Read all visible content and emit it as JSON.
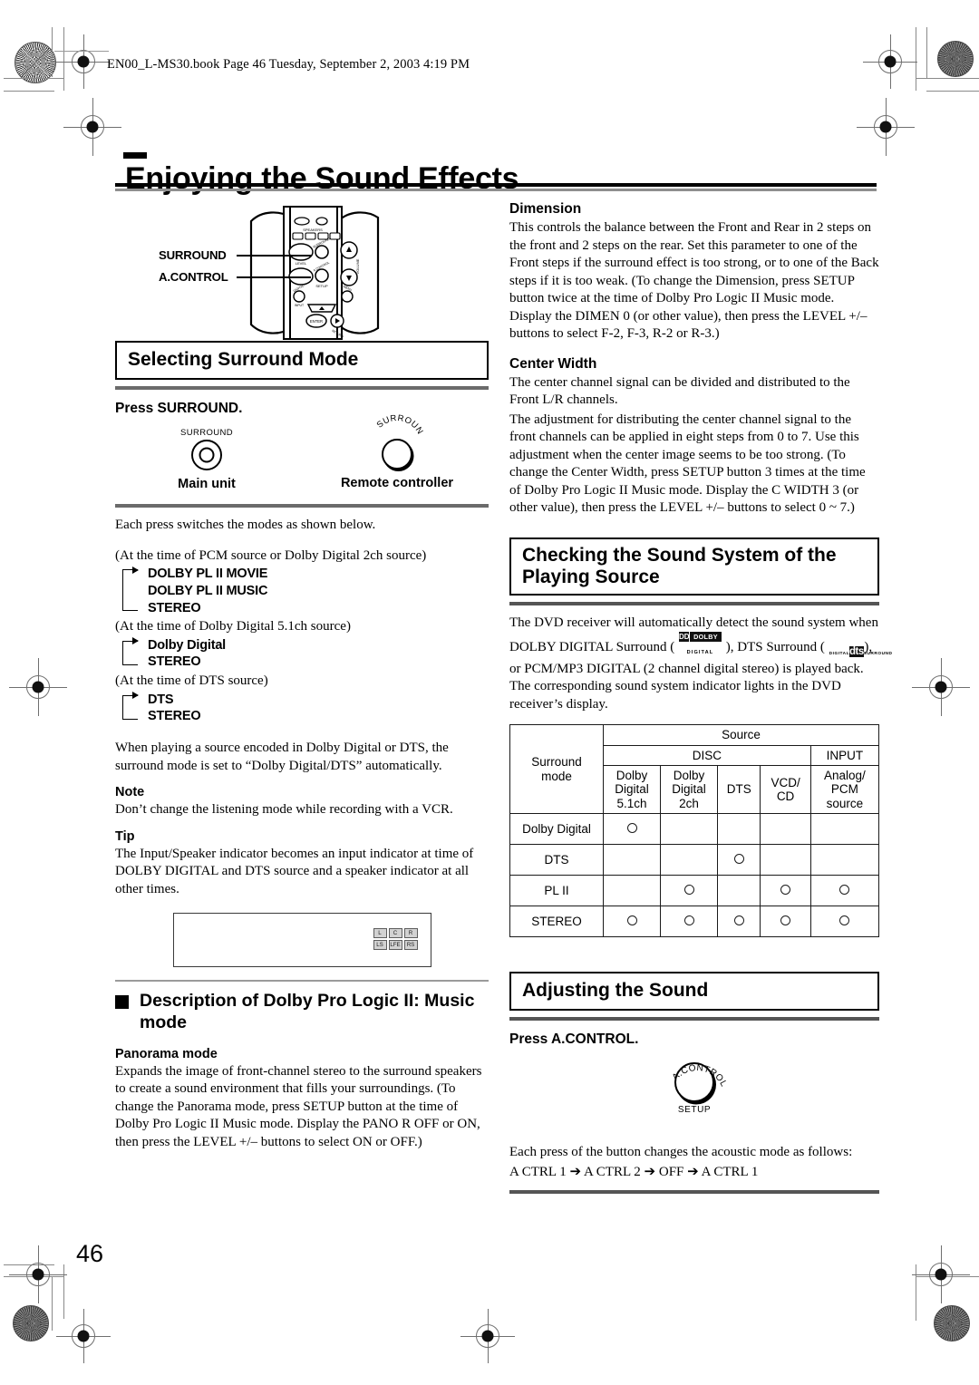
{
  "page": {
    "file_header": "EN00_L-MS30.book  Page 46  Tuesday, September 2, 2003  4:19 PM",
    "title": "Enjoying the Sound Effects",
    "page_number": "46"
  },
  "remote_callouts": {
    "surround": "SURROUND",
    "acontrol": "A.CONTROL"
  },
  "selecting_surround": {
    "banner": "Selecting Surround Mode",
    "press_instruction": "Press SURROUND.",
    "knobs": [
      {
        "cap": "SURROUND",
        "label": "Main unit"
      },
      {
        "cap": "SURROUND",
        "label": "Remote controller"
      }
    ],
    "intro": "Each press switches the modes as shown below.",
    "groups": [
      {
        "condition": "(At the time of PCM source or Dolby Digital 2ch source)",
        "items": [
          "DOLBY PL II MOVIE",
          "DOLBY PL II MUSIC",
          "STEREO"
        ]
      },
      {
        "condition": "(At the time of Dolby Digital 5.1ch source)",
        "items": [
          "Dolby Digital",
          "STEREO"
        ]
      },
      {
        "condition": "(At the time of DTS source)",
        "items": [
          "DTS",
          "STEREO"
        ]
      }
    ],
    "auto_paragraph": "When playing a source encoded in Dolby Digital or DTS, the surround mode is set to “Dolby Digital/DTS” automatically.",
    "note_heading": "Note",
    "note_text": "Don’t change the listening mode while recording with a VCR.",
    "tip_heading": "Tip",
    "tip_text": "The Input/Speaker indicator becomes an input indicator at time of DOLBY DIGITAL and DTS source and a speaker indicator at all other times.",
    "display_indicators": [
      "L",
      "C",
      "R",
      "LS",
      "LFE",
      "RS"
    ]
  },
  "pl2_music": {
    "heading": "Description of Dolby Pro Logic II: Music mode",
    "panorama_heading": "Panorama mode",
    "panorama_text": "Expands the image of front-channel stereo to the surround speakers to create a sound environment that fills your surroundings. (To change the Panorama mode, press SETUP button at the time of Dolby Pro Logic II Music mode. Display the PANO R OFF or ON, then press the LEVEL +/– buttons to select ON or OFF.)",
    "dimension_heading": "Dimension",
    "dimension_text": "This controls the balance between the Front and Rear in 2 steps on the front and 2 steps on the rear. Set this parameter to one of the Front steps if the surround effect is too strong, or to one of the Back steps if it is too weak. (To change the Dimension, press SETUP button twice at the time of Dolby Pro Logic II Music mode. Display the DIMEN 0 (or other value), then press the LEVEL +/– buttons to select F-2, F-3, R-2 or R-3.)",
    "center_width_heading": "Center Width",
    "center_width_text_1": "The center channel signal can be divided and distributed to the Front L/R channels.",
    "center_width_text_2": "The adjustment for distributing the center channel signal to the front channels can be applied in eight steps from 0 to 7. Use this adjustment when the center image seems to be too strong. (To change the Center Width, press SETUP button 3 times at the time of Dolby Pro Logic II Music mode. Display the C WIDTH 3 (or other value), then press the LEVEL +/– buttons to select 0 ~ 7.)"
  },
  "checking_sound_system": {
    "banner_line1": "Checking the Sound System of the",
    "banner_line2": "Playing Source",
    "para_part1": "The DVD receiver will automatically detect the sound system when DOLBY DIGITAL Surround ( ",
    "para_part2": " ), DTS Surround ( ",
    "para_part3": " ), or PCM/MP3 DIGITAL (2 channel digital stereo) is played back. The corresponding sound system indicator lights in the DVD receiver’s display.",
    "logo_dolby": {
      "mark": "DD",
      "word": "DOLBY",
      "sub": "DIGITAL"
    },
    "logo_dts": {
      "top": "DIGITAL",
      "mid": "dts",
      "bot": "SURROUND"
    }
  },
  "source_table": {
    "row_header": "Surround mode",
    "row_header_line1": "Surround",
    "row_header_line2": "mode",
    "source_label": "Source",
    "groups": [
      {
        "label": "DISC",
        "span": 4
      },
      {
        "label": "INPUT",
        "span": 1
      }
    ],
    "columns": [
      "Dolby Digital 5.1ch",
      "Dolby Digital 2ch",
      "DTS",
      "VCD/ CD",
      "Analog/ PCM source"
    ],
    "column_lines": [
      [
        "Dolby",
        "Digital",
        "5.1ch"
      ],
      [
        "Dolby",
        "Digital",
        "2ch"
      ],
      [
        "DTS"
      ],
      [
        "VCD/",
        "CD"
      ],
      [
        "Analog/",
        "PCM",
        "source"
      ]
    ],
    "rows": [
      {
        "mode": "Dolby Digital",
        "marks": [
          true,
          false,
          false,
          false,
          false
        ]
      },
      {
        "mode": "DTS",
        "marks": [
          false,
          false,
          true,
          false,
          false
        ]
      },
      {
        "mode": "PL II",
        "marks": [
          false,
          true,
          false,
          true,
          true
        ]
      },
      {
        "mode": "STEREO",
        "marks": [
          true,
          true,
          true,
          true,
          true
        ]
      }
    ],
    "mark_symbol": "○"
  },
  "adjusting_sound": {
    "banner": "Adjusting the Sound",
    "press_instruction": "Press A.CONTROL.",
    "knob_cap": "A.CONTROL",
    "knob_sub": "SETUP",
    "description": "Each press of the button changes the acoustic mode as follows:",
    "flow": "A CTRL 1 ➔ A CTRL 2 ➔ OFF ➔ A CTRL 1"
  }
}
